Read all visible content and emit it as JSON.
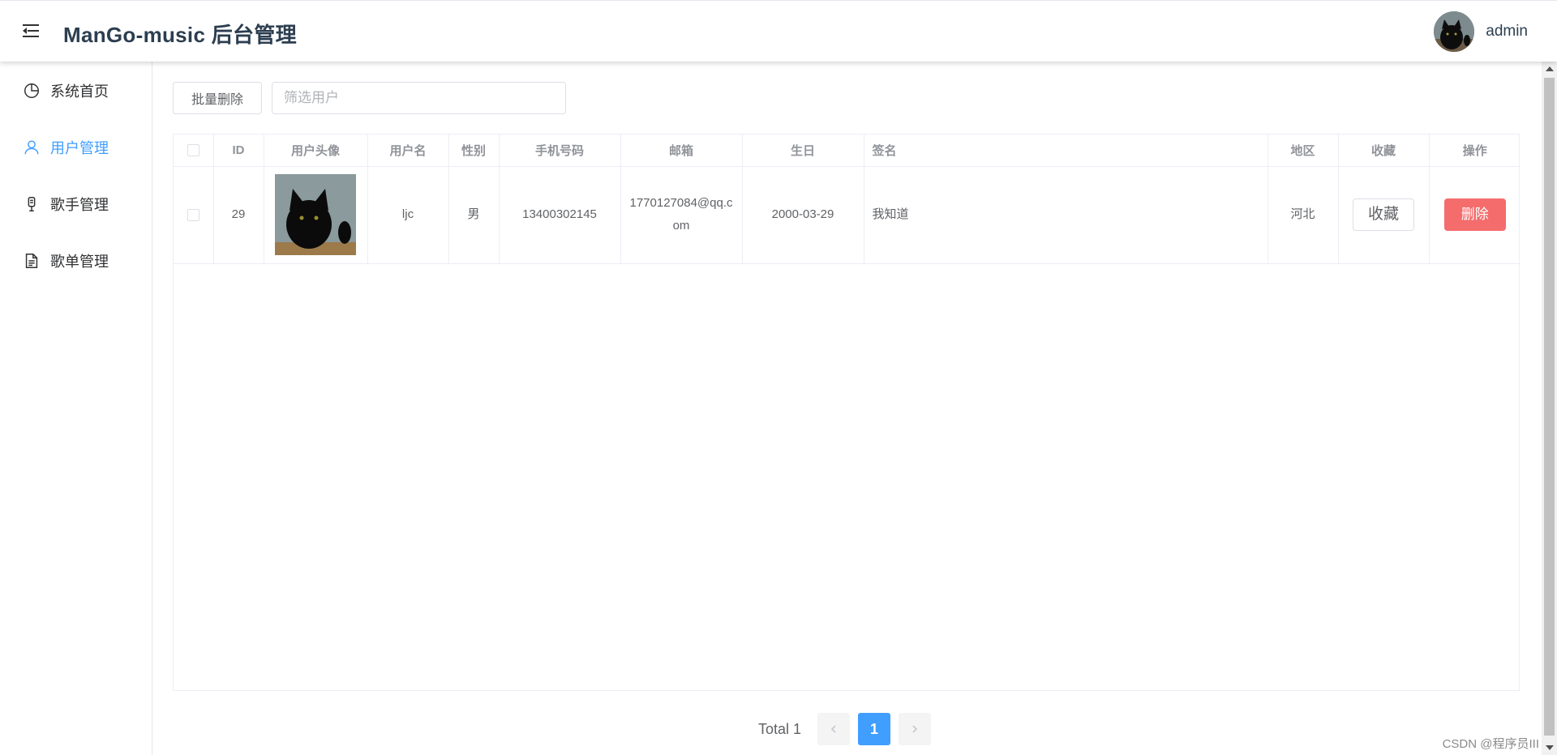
{
  "header": {
    "title": "ManGo-music 后台管理",
    "username": "admin"
  },
  "sidebar": {
    "items": [
      {
        "label": "系统首页",
        "icon": "pie-chart-icon",
        "active": false
      },
      {
        "label": "用户管理",
        "icon": "user-icon",
        "active": true
      },
      {
        "label": "歌手管理",
        "icon": "microphone-icon",
        "active": false
      },
      {
        "label": "歌单管理",
        "icon": "document-icon",
        "active": false
      }
    ]
  },
  "toolbar": {
    "batch_delete_label": "批量删除",
    "search_placeholder": "筛选用户"
  },
  "table": {
    "columns": [
      "ID",
      "用户头像",
      "用户名",
      "性别",
      "手机号码",
      "邮箱",
      "生日",
      "签名",
      "地区",
      "收藏",
      "操作"
    ],
    "rows": [
      {
        "id": "29",
        "username": "ljc",
        "gender": "男",
        "phone": "13400302145",
        "email": "1770127084@qq.com",
        "birthday": "2000-03-29",
        "signature": "我知道",
        "region": "河北",
        "collect_label": "收藏",
        "delete_label": "删除"
      }
    ]
  },
  "pagination": {
    "total_label": "Total 1",
    "current_page": "1",
    "prev_icon": "chevron-left-icon",
    "next_icon": "chevron-right-icon"
  },
  "watermark": "CSDN @程序员III",
  "colors": {
    "accent": "#409eff",
    "danger": "#f56c6c"
  }
}
